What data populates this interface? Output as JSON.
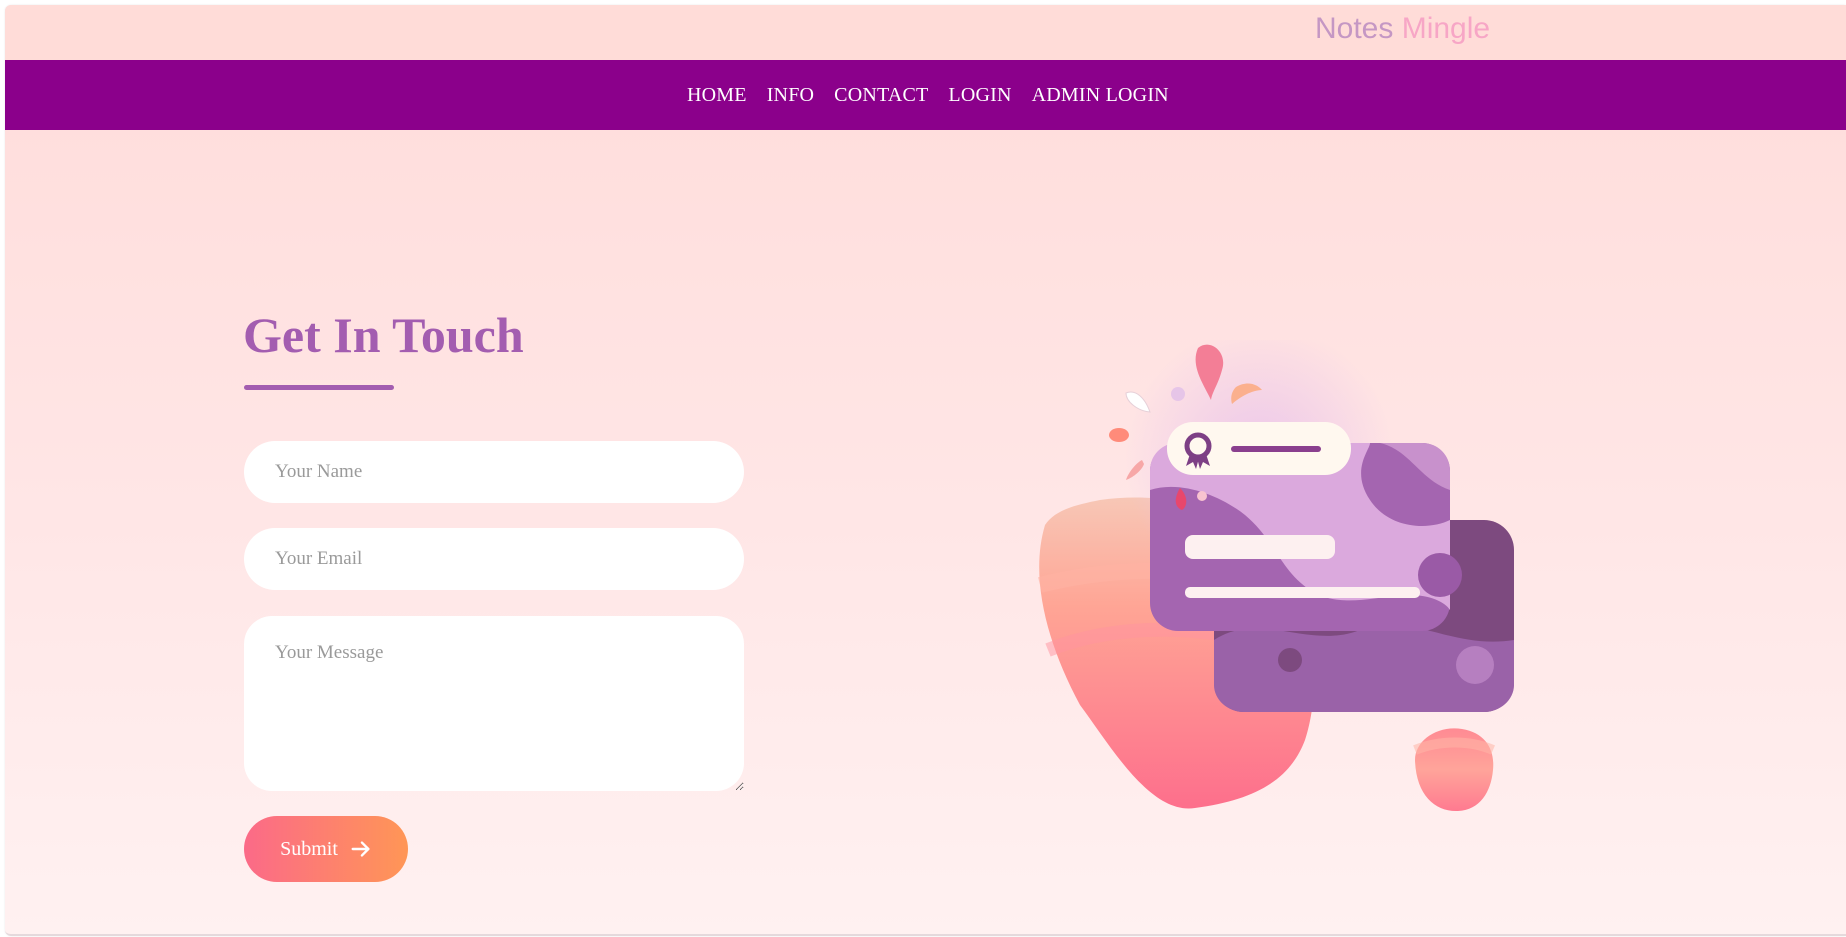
{
  "brand": {
    "part1": "Notes ",
    "part2": "Mingle"
  },
  "nav": {
    "items": [
      {
        "label": "HOME"
      },
      {
        "label": "INFO"
      },
      {
        "label": "CONTACT"
      },
      {
        "label": "LOGIN"
      },
      {
        "label": "ADMIN LOGIN"
      }
    ]
  },
  "contact": {
    "heading": "Get In Touch",
    "name_placeholder": "Your Name",
    "email_placeholder": "Your Email",
    "message_placeholder": "Your Message",
    "submit_label": "Submit"
  },
  "colors": {
    "navbar": "#8b008b",
    "heading": "#a35db0",
    "button_start": "#fb6a88",
    "button_end": "#ff9656"
  },
  "icons": {
    "submit": "arrow-right-icon",
    "badge": "award-ribbon-icon"
  }
}
